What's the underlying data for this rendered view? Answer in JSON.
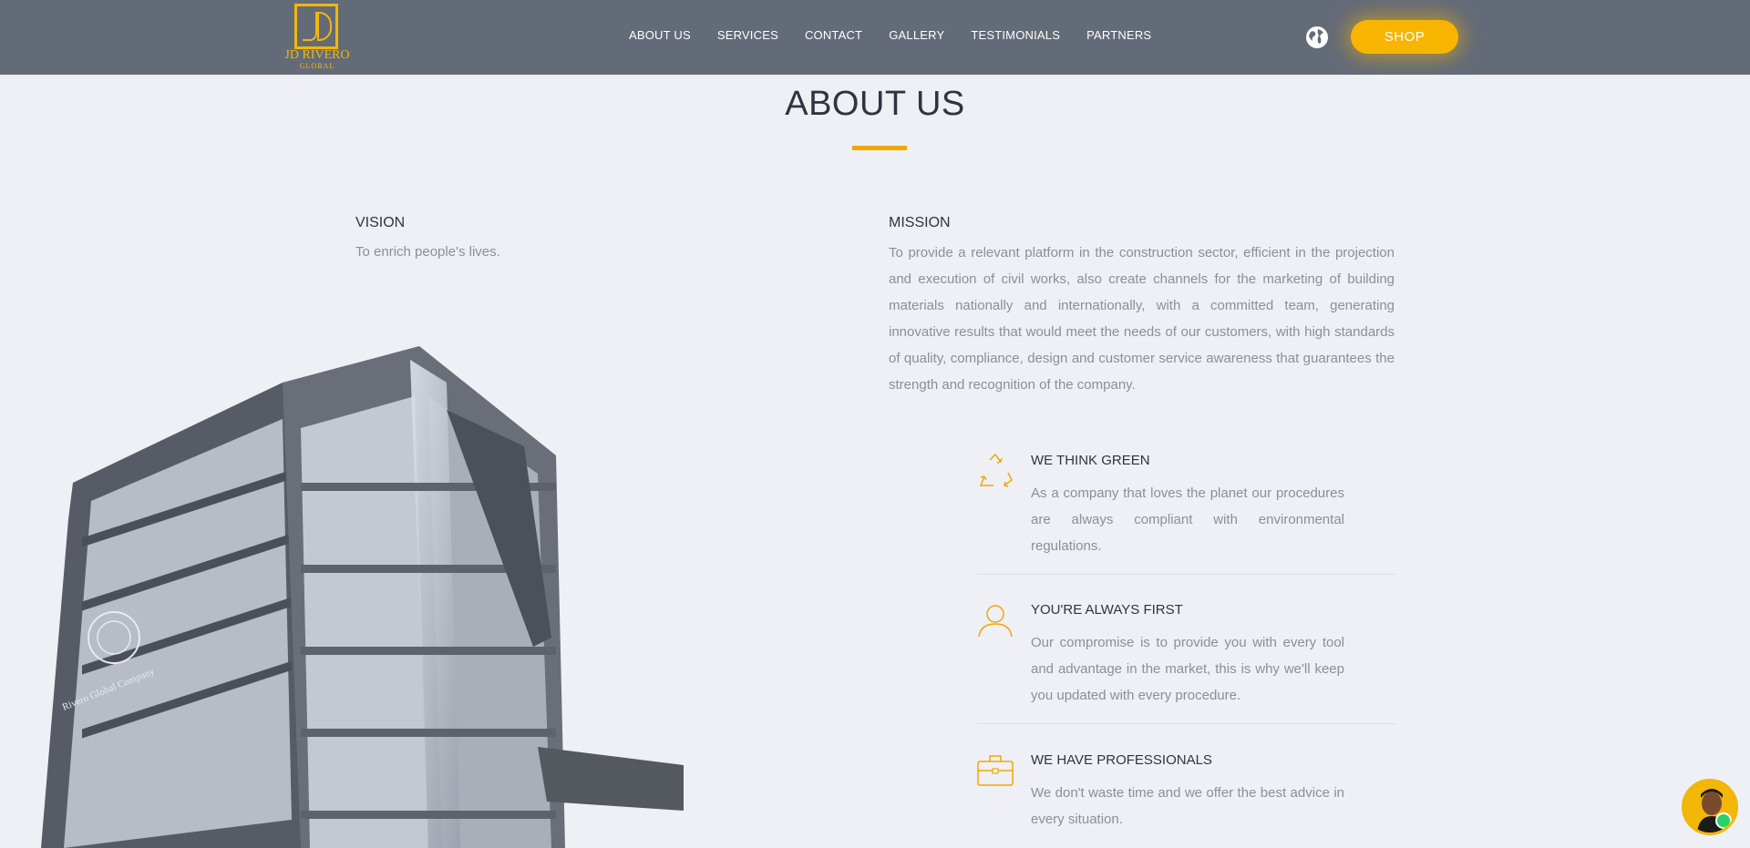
{
  "brand": {
    "name": "JD RIVERO",
    "sub": "GLOBAL"
  },
  "nav": [
    "ABOUT US",
    "SERVICES",
    "CONTACT",
    "GALLERY",
    "TESTIMONIALS",
    "PARTNERS"
  ],
  "header": {
    "shop_label": "SHOP",
    "globe_icon": "globe-icon"
  },
  "page": {
    "title": "ABOUT US"
  },
  "vision": {
    "heading": "VISION",
    "text": "To enrich people's lives."
  },
  "mission": {
    "heading": "MISSION",
    "text": "To provide a relevant platform in the construction sector, efficient in the projection and execution of civil works, also create channels for the marketing of building materials nationally and internationally, with a committed team, generating innovative results that would meet the needs of our customers, with high standards of quality, compliance, design and customer service awareness that guarantees the strength and recognition of the company."
  },
  "building": {
    "sign": "Rivero Global Company"
  },
  "features": [
    {
      "icon": "recycle-icon",
      "title": "WE THINK GREEN",
      "text": "As a company that loves the planet our procedures are always compliant with environmental regulations."
    },
    {
      "icon": "user-icon",
      "title": "YOU'RE ALWAYS FIRST",
      "text": "Our compromise is to provide you with every tool and advantage in the market, this is why we'll keep you updated with every procedure."
    },
    {
      "icon": "briefcase-icon",
      "title": "WE HAVE PROFESSIONALS",
      "text": "We don't waste time and we offer the best advice in every situation."
    }
  ],
  "colors": {
    "accent": "#f7b500",
    "header": "#646b78",
    "background": "#eef0f5"
  },
  "chat": {
    "icon": "whatsapp-icon"
  }
}
